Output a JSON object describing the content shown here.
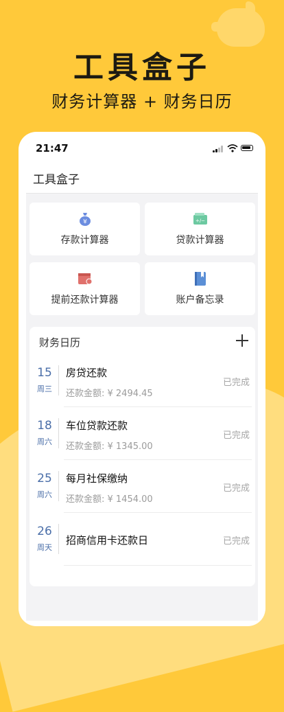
{
  "hero": {
    "title": "工具盒子",
    "subtitle": "财务计算器 + 财务日历"
  },
  "status_bar": {
    "time": "21:47"
  },
  "navbar": {
    "title": "工具盒子"
  },
  "tools": [
    {
      "label": "存款计算器",
      "icon": "money-bag-icon",
      "color": "#6C8DE0"
    },
    {
      "label": "贷款计算器",
      "icon": "card-calculator-icon",
      "color": "#6CC9A1"
    },
    {
      "label": "提前还款计算器",
      "icon": "calendar-clock-icon",
      "color": "#E0716C"
    },
    {
      "label": "账户备忘录",
      "icon": "book-icon",
      "color": "#5B8FD6"
    }
  ],
  "calendar": {
    "title": "财务日历",
    "events": [
      {
        "day": "15",
        "weekday": "周三",
        "title": "房贷还款",
        "amount": "还款金额: ¥ 2494.45",
        "status": "已完成"
      },
      {
        "day": "18",
        "weekday": "周六",
        "title": "车位贷款还款",
        "amount": "还款金额: ¥ 1345.00",
        "status": "已完成"
      },
      {
        "day": "25",
        "weekday": "周六",
        "title": "每月社保缴纳",
        "amount": "还款金额: ¥ 1454.00",
        "status": "已完成"
      },
      {
        "day": "26",
        "weekday": "周天",
        "title": "招商信用卡还款日",
        "amount": "",
        "status": "已完成"
      }
    ]
  },
  "colors": {
    "background": "#FFC93A",
    "date_accent": "#4A6EA8"
  }
}
